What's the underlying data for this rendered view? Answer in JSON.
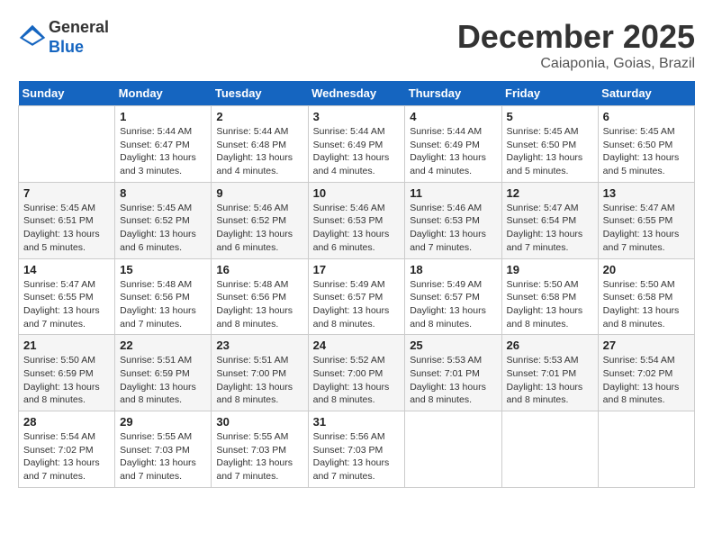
{
  "header": {
    "logo_line1": "General",
    "logo_line2": "Blue",
    "month": "December 2025",
    "location": "Caiaponia, Goias, Brazil"
  },
  "days_of_week": [
    "Sunday",
    "Monday",
    "Tuesday",
    "Wednesday",
    "Thursday",
    "Friday",
    "Saturday"
  ],
  "weeks": [
    [
      {
        "day": "",
        "sunrise": "",
        "sunset": "",
        "daylight": ""
      },
      {
        "day": "1",
        "sunrise": "5:44 AM",
        "sunset": "6:47 PM",
        "daylight": "13 hours and 3 minutes."
      },
      {
        "day": "2",
        "sunrise": "5:44 AM",
        "sunset": "6:48 PM",
        "daylight": "13 hours and 4 minutes."
      },
      {
        "day": "3",
        "sunrise": "5:44 AM",
        "sunset": "6:49 PM",
        "daylight": "13 hours and 4 minutes."
      },
      {
        "day": "4",
        "sunrise": "5:44 AM",
        "sunset": "6:49 PM",
        "daylight": "13 hours and 4 minutes."
      },
      {
        "day": "5",
        "sunrise": "5:45 AM",
        "sunset": "6:50 PM",
        "daylight": "13 hours and 5 minutes."
      },
      {
        "day": "6",
        "sunrise": "5:45 AM",
        "sunset": "6:50 PM",
        "daylight": "13 hours and 5 minutes."
      }
    ],
    [
      {
        "day": "7",
        "sunrise": "5:45 AM",
        "sunset": "6:51 PM",
        "daylight": "13 hours and 5 minutes."
      },
      {
        "day": "8",
        "sunrise": "5:45 AM",
        "sunset": "6:52 PM",
        "daylight": "13 hours and 6 minutes."
      },
      {
        "day": "9",
        "sunrise": "5:46 AM",
        "sunset": "6:52 PM",
        "daylight": "13 hours and 6 minutes."
      },
      {
        "day": "10",
        "sunrise": "5:46 AM",
        "sunset": "6:53 PM",
        "daylight": "13 hours and 6 minutes."
      },
      {
        "day": "11",
        "sunrise": "5:46 AM",
        "sunset": "6:53 PM",
        "daylight": "13 hours and 7 minutes."
      },
      {
        "day": "12",
        "sunrise": "5:47 AM",
        "sunset": "6:54 PM",
        "daylight": "13 hours and 7 minutes."
      },
      {
        "day": "13",
        "sunrise": "5:47 AM",
        "sunset": "6:55 PM",
        "daylight": "13 hours and 7 minutes."
      }
    ],
    [
      {
        "day": "14",
        "sunrise": "5:47 AM",
        "sunset": "6:55 PM",
        "daylight": "13 hours and 7 minutes."
      },
      {
        "day": "15",
        "sunrise": "5:48 AM",
        "sunset": "6:56 PM",
        "daylight": "13 hours and 7 minutes."
      },
      {
        "day": "16",
        "sunrise": "5:48 AM",
        "sunset": "6:56 PM",
        "daylight": "13 hours and 8 minutes."
      },
      {
        "day": "17",
        "sunrise": "5:49 AM",
        "sunset": "6:57 PM",
        "daylight": "13 hours and 8 minutes."
      },
      {
        "day": "18",
        "sunrise": "5:49 AM",
        "sunset": "6:57 PM",
        "daylight": "13 hours and 8 minutes."
      },
      {
        "day": "19",
        "sunrise": "5:50 AM",
        "sunset": "6:58 PM",
        "daylight": "13 hours and 8 minutes."
      },
      {
        "day": "20",
        "sunrise": "5:50 AM",
        "sunset": "6:58 PM",
        "daylight": "13 hours and 8 minutes."
      }
    ],
    [
      {
        "day": "21",
        "sunrise": "5:50 AM",
        "sunset": "6:59 PM",
        "daylight": "13 hours and 8 minutes."
      },
      {
        "day": "22",
        "sunrise": "5:51 AM",
        "sunset": "6:59 PM",
        "daylight": "13 hours and 8 minutes."
      },
      {
        "day": "23",
        "sunrise": "5:51 AM",
        "sunset": "7:00 PM",
        "daylight": "13 hours and 8 minutes."
      },
      {
        "day": "24",
        "sunrise": "5:52 AM",
        "sunset": "7:00 PM",
        "daylight": "13 hours and 8 minutes."
      },
      {
        "day": "25",
        "sunrise": "5:53 AM",
        "sunset": "7:01 PM",
        "daylight": "13 hours and 8 minutes."
      },
      {
        "day": "26",
        "sunrise": "5:53 AM",
        "sunset": "7:01 PM",
        "daylight": "13 hours and 8 minutes."
      },
      {
        "day": "27",
        "sunrise": "5:54 AM",
        "sunset": "7:02 PM",
        "daylight": "13 hours and 8 minutes."
      }
    ],
    [
      {
        "day": "28",
        "sunrise": "5:54 AM",
        "sunset": "7:02 PM",
        "daylight": "13 hours and 7 minutes."
      },
      {
        "day": "29",
        "sunrise": "5:55 AM",
        "sunset": "7:03 PM",
        "daylight": "13 hours and 7 minutes."
      },
      {
        "day": "30",
        "sunrise": "5:55 AM",
        "sunset": "7:03 PM",
        "daylight": "13 hours and 7 minutes."
      },
      {
        "day": "31",
        "sunrise": "5:56 AM",
        "sunset": "7:03 PM",
        "daylight": "13 hours and 7 minutes."
      },
      {
        "day": "",
        "sunrise": "",
        "sunset": "",
        "daylight": ""
      },
      {
        "day": "",
        "sunrise": "",
        "sunset": "",
        "daylight": ""
      },
      {
        "day": "",
        "sunrise": "",
        "sunset": "",
        "daylight": ""
      }
    ]
  ]
}
